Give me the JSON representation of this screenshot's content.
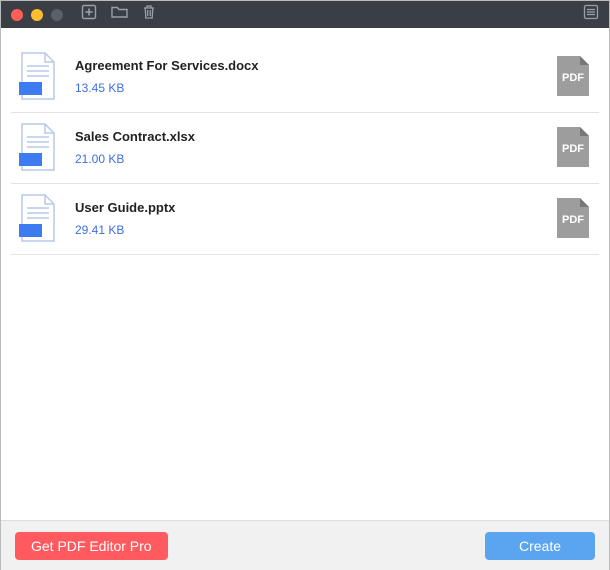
{
  "files": [
    {
      "name": "Agreement For Services.docx",
      "size": "13.45 KB"
    },
    {
      "name": "Sales Contract.xlsx",
      "size": "21.00 KB"
    },
    {
      "name": "User Guide.pptx",
      "size": "29.41 KB"
    }
  ],
  "pdf_badge": "PDF",
  "footer": {
    "upgrade": "Get PDF Editor Pro",
    "create": "Create"
  }
}
